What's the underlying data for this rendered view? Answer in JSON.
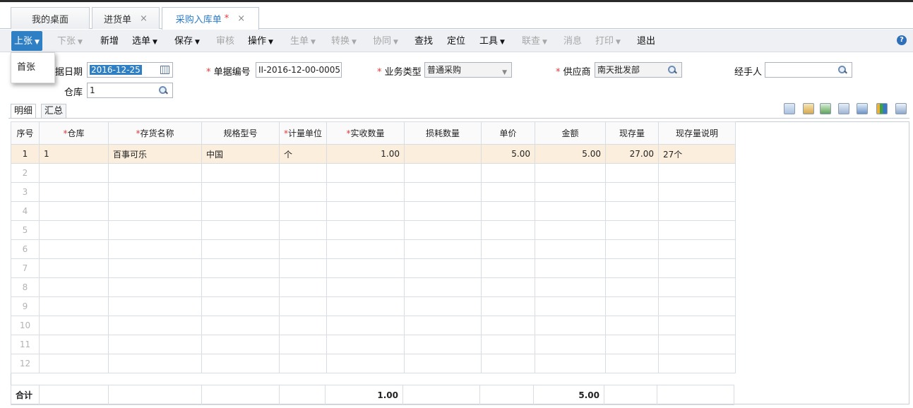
{
  "tabs": [
    {
      "label": "我的桌面",
      "closable": false
    },
    {
      "label": "进货单",
      "closable": true
    },
    {
      "label": "采购入库单",
      "closable": true,
      "modified": "*"
    }
  ],
  "tab_close_glyph": "×",
  "toolbar": {
    "items": [
      {
        "label": "上张",
        "dropdown": true,
        "enabled": true,
        "selected": true
      },
      {
        "label": "下张",
        "dropdown": true,
        "enabled": false
      },
      {
        "label": "新增",
        "enabled": true
      },
      {
        "label": "选单",
        "dropdown": true,
        "enabled": true
      },
      {
        "label": "保存",
        "dropdown": true,
        "enabled": true
      },
      {
        "label": "审核",
        "enabled": false
      },
      {
        "label": "操作",
        "dropdown": true,
        "enabled": true
      },
      {
        "label": "生单",
        "dropdown": true,
        "enabled": false
      },
      {
        "label": "转换",
        "dropdown": true,
        "enabled": false
      },
      {
        "label": "协同",
        "dropdown": true,
        "enabled": false
      },
      {
        "label": "查找",
        "enabled": true
      },
      {
        "label": "定位",
        "enabled": true
      },
      {
        "label": "工具",
        "dropdown": true,
        "enabled": true
      },
      {
        "label": "联查",
        "dropdown": true,
        "enabled": false
      },
      {
        "label": "消息",
        "enabled": false
      },
      {
        "label": "打印",
        "dropdown": true,
        "enabled": false
      },
      {
        "label": "退出",
        "enabled": true
      }
    ],
    "help_icon": "help-icon",
    "help_glyph": "?"
  },
  "dropdown_menu": {
    "items": [
      "首张"
    ]
  },
  "form": {
    "date_label": "据日期",
    "date_value": "2016-12-25",
    "code_label": "单据编号",
    "code_value": "II-2016-12-00-0005",
    "biztype_label": "业务类型",
    "biztype_value": "普通采购",
    "supplier_label": "供应商",
    "supplier_value": "南天批发部",
    "handler_label": "经手人",
    "handler_value": "",
    "warehouse_label": "仓库",
    "warehouse_value": "1",
    "required_mark": "*"
  },
  "subtabs": [
    "明细",
    "汇总"
  ],
  "grid": {
    "columns": [
      "序号",
      "仓库",
      "存货名称",
      "规格型号",
      "计量单位",
      "实收数量",
      "损耗数量",
      "单价",
      "金额",
      "现存量",
      "现存量说明"
    ],
    "required": [
      false,
      true,
      true,
      false,
      true,
      true,
      false,
      false,
      false,
      false,
      false
    ],
    "rows": [
      [
        "1",
        "1",
        "百事可乐",
        "中国",
        "个",
        "1.00",
        "",
        "5.00",
        "5.00",
        "27.00",
        "27个"
      ],
      [
        "2",
        "",
        "",
        "",
        "",
        "",
        "",
        "",
        "",
        "",
        ""
      ],
      [
        "3",
        "",
        "",
        "",
        "",
        "",
        "",
        "",
        "",
        "",
        ""
      ],
      [
        "4",
        "",
        "",
        "",
        "",
        "",
        "",
        "",
        "",
        "",
        ""
      ],
      [
        "5",
        "",
        "",
        "",
        "",
        "",
        "",
        "",
        "",
        "",
        ""
      ],
      [
        "6",
        "",
        "",
        "",
        "",
        "",
        "",
        "",
        "",
        "",
        ""
      ],
      [
        "7",
        "",
        "",
        "",
        "",
        "",
        "",
        "",
        "",
        "",
        ""
      ],
      [
        "8",
        "",
        "",
        "",
        "",
        "",
        "",
        "",
        "",
        "",
        ""
      ],
      [
        "9",
        "",
        "",
        "",
        "",
        "",
        "",
        "",
        "",
        "",
        ""
      ],
      [
        "10",
        "",
        "",
        "",
        "",
        "",
        "",
        "",
        "",
        "",
        ""
      ],
      [
        "11",
        "",
        "",
        "",
        "",
        "",
        "",
        "",
        "",
        "",
        ""
      ],
      [
        "12",
        "",
        "",
        "",
        "",
        "",
        "",
        "",
        "",
        "",
        ""
      ]
    ],
    "total": [
      "合计",
      "",
      "",
      "",
      "",
      "1.00",
      "",
      "",
      "5.00",
      "",
      ""
    ]
  },
  "colors": {
    "accent": "#2f7fc5",
    "selected_row": "#fbeedd",
    "required": "#e23a3a"
  }
}
